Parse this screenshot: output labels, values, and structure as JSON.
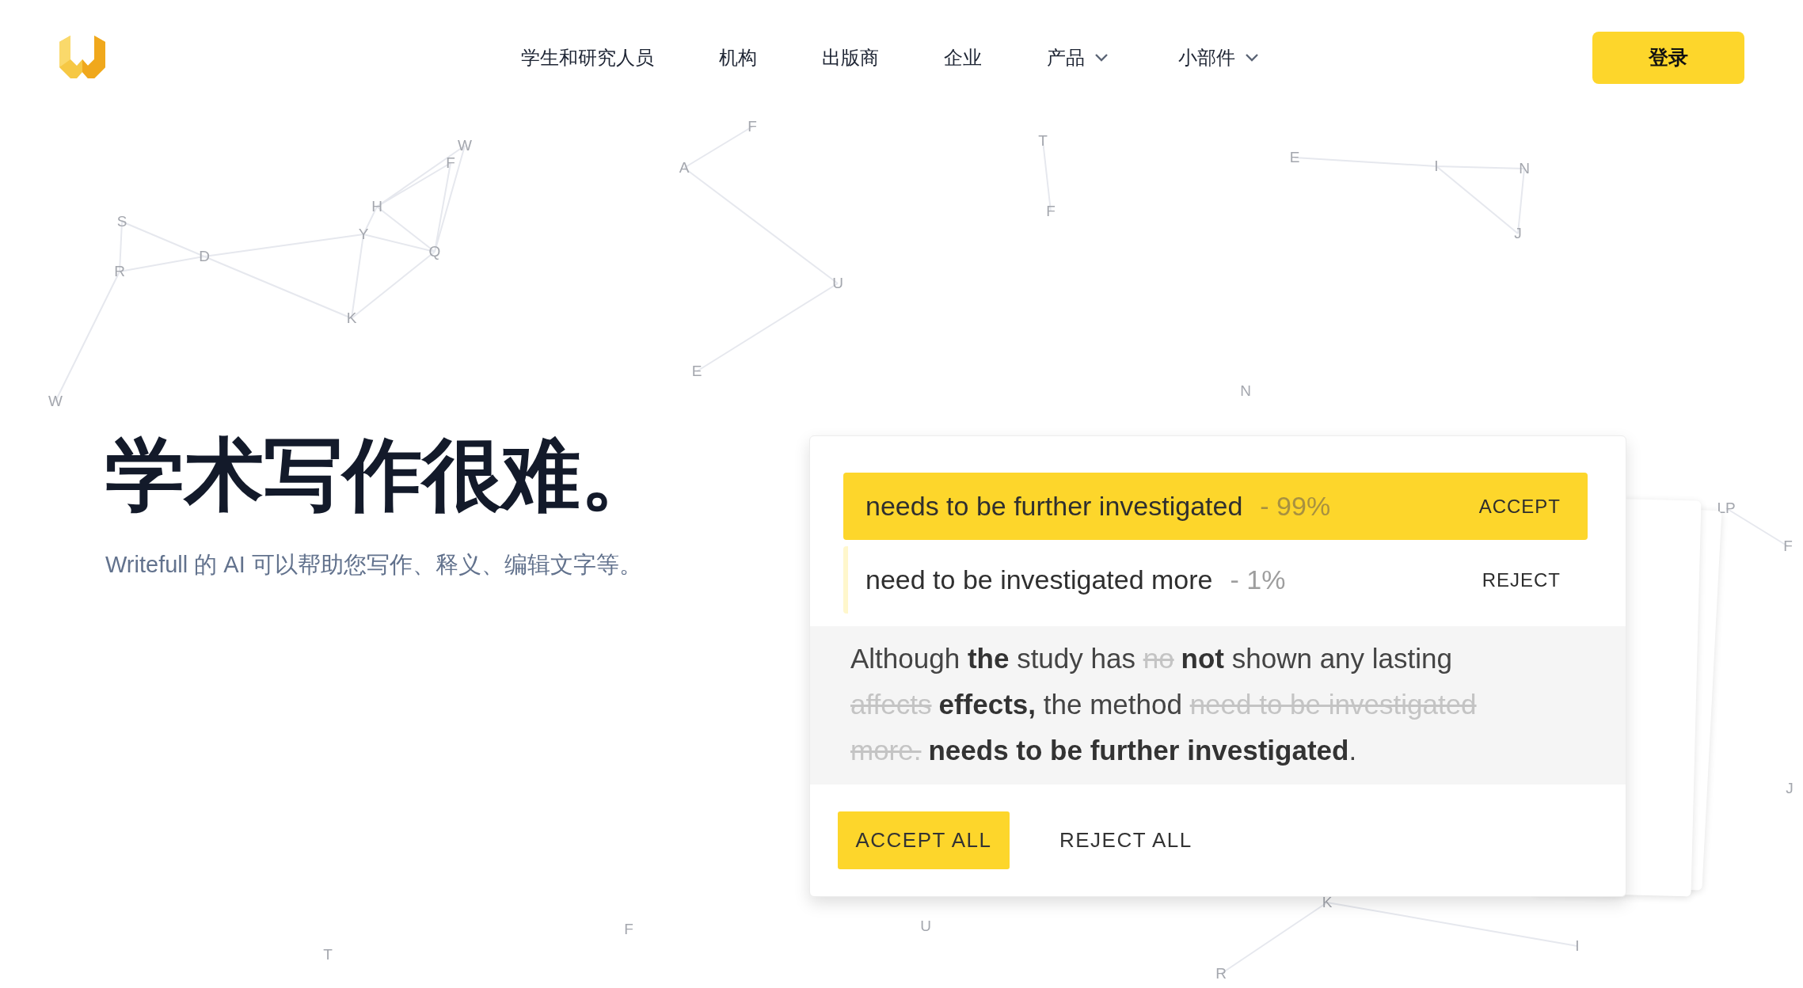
{
  "header": {
    "nav_items": [
      {
        "label": "学生和研究人员",
        "dropdown": false
      },
      {
        "label": "机构",
        "dropdown": false
      },
      {
        "label": "出版商",
        "dropdown": false
      },
      {
        "label": "企业",
        "dropdown": false
      },
      {
        "label": "产品",
        "dropdown": true
      },
      {
        "label": "小部件",
        "dropdown": true
      }
    ],
    "login_button": "登录"
  },
  "background_letters": [
    "S",
    "D",
    "R",
    "H",
    "Y",
    "Q",
    "K",
    "F",
    "W",
    "A",
    "F",
    "U",
    "E",
    "W",
    "T",
    "F",
    "E",
    "I",
    "N",
    "J",
    "N",
    "LP",
    "F",
    "J",
    "T",
    "F",
    "U",
    "K",
    "R",
    "I"
  ],
  "hero": {
    "title": "学术写作很难。",
    "subtitle": "Writefull 的 AI 可以帮助您写作、释义、编辑文字等。"
  },
  "card": {
    "suggestions": [
      {
        "text": "needs to be further investigated",
        "score": "- 99%",
        "action": "ACCEPT",
        "selected": true
      },
      {
        "text": "need to be investigated more",
        "score": "- 1%",
        "action": "REJECT",
        "selected": false
      }
    ],
    "sentence": [
      {
        "text": "Although ",
        "kind": "plain"
      },
      {
        "text": "the",
        "kind": "added"
      },
      {
        "text": " study has ",
        "kind": "plain"
      },
      {
        "text": "no",
        "kind": "deleted"
      },
      {
        "text": "not",
        "kind": "added"
      },
      {
        "text": " shown any lasting ",
        "kind": "plain"
      },
      {
        "text": "affects",
        "kind": "deleted"
      },
      {
        "text": "effects,",
        "kind": "added"
      },
      {
        "text": " the method ",
        "kind": "plain"
      },
      {
        "text": "need to be investigated more.",
        "kind": "deleted"
      },
      {
        "text": "needs to be further investigated",
        "kind": "added"
      },
      {
        "text": ".",
        "kind": "plain"
      }
    ],
    "accept_all": "ACCEPT ALL",
    "reject_all": "REJECT ALL"
  }
}
